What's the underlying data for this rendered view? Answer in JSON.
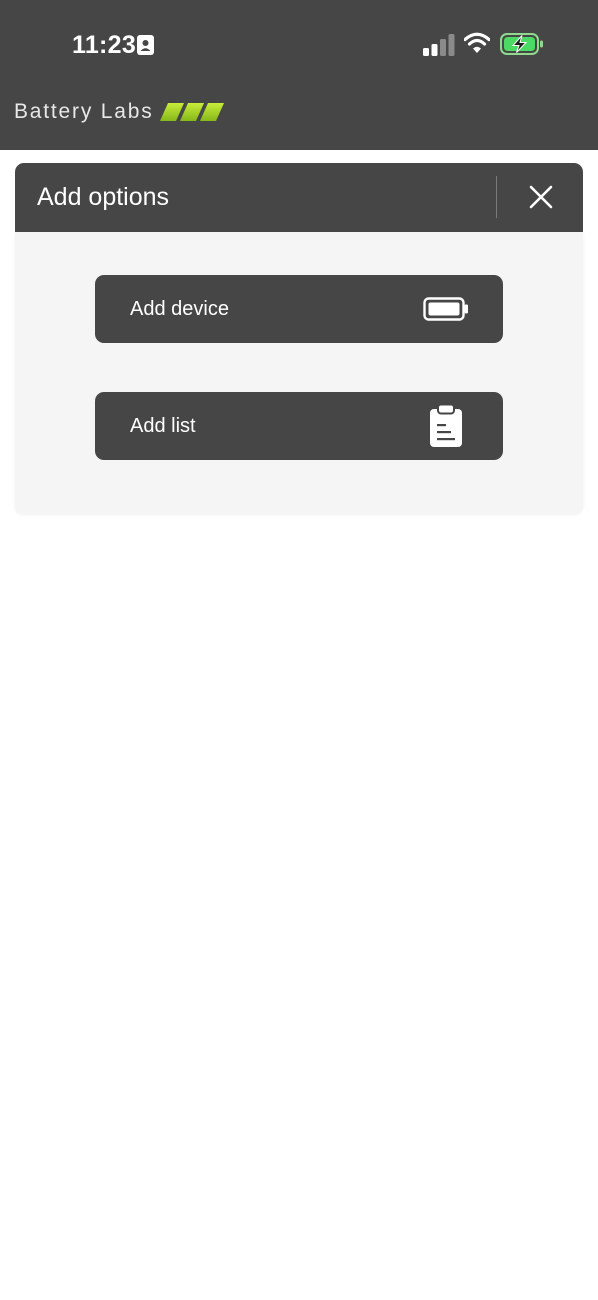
{
  "status_bar": {
    "time": "11:23",
    "icons": [
      "id-card-icon",
      "cellular-signal-icon",
      "wifi-icon",
      "battery-charging-icon"
    ],
    "battery_color": "#4cd964"
  },
  "app": {
    "logo_text": "Battery Labs",
    "logo_accent_color": "#a8d81c",
    "header_color": "#464646"
  },
  "dialog": {
    "title": "Add options",
    "close_icon": "close-icon",
    "options": [
      {
        "label": "Add device",
        "icon": "battery-icon"
      },
      {
        "label": "Add list",
        "icon": "clipboard-icon"
      }
    ]
  }
}
